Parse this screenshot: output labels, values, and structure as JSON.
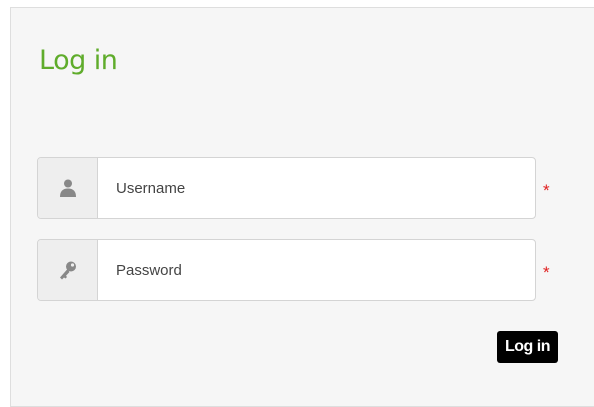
{
  "form": {
    "title": "Log in",
    "username": {
      "placeholder": "Username",
      "icon": "user-icon",
      "required_marker": "*"
    },
    "password": {
      "placeholder": "Password",
      "icon": "key-icon",
      "required_marker": "*"
    },
    "submit_label": "Log in"
  },
  "colors": {
    "title": "#5fac2b",
    "required": "#e02020",
    "button_bg": "#000000",
    "button_text": "#ffffff",
    "panel_bg": "#f6f6f6",
    "addon_bg": "#eeeeee"
  }
}
